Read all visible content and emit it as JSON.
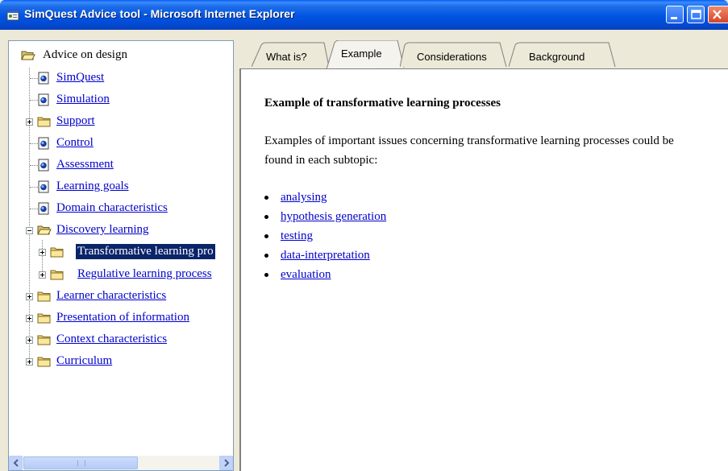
{
  "window": {
    "title": "SimQuest Advice tool - Microsoft Internet Explorer",
    "buttons": [
      "minimize",
      "maximize",
      "close"
    ]
  },
  "tree": {
    "root": {
      "label": "Advice on design",
      "icon": "open-folder-icon"
    },
    "items": [
      {
        "label": "SimQuest",
        "icon": "document-icon",
        "expander": "none"
      },
      {
        "label": "Simulation",
        "icon": "document-icon",
        "expander": "none"
      },
      {
        "label": "Support",
        "icon": "folder-icon",
        "expander": "plus"
      },
      {
        "label": "Control",
        "icon": "document-icon",
        "expander": "none"
      },
      {
        "label": "Assessment",
        "icon": "document-icon",
        "expander": "none"
      },
      {
        "label": "Learning goals",
        "icon": "document-icon",
        "expander": "none"
      },
      {
        "label": "Domain characteristics",
        "icon": "document-icon",
        "expander": "none"
      },
      {
        "label": "Discovery learning",
        "icon": "open-folder-icon",
        "expander": "minus",
        "children": [
          {
            "label": "Transformative learning pro",
            "icon": "folder-icon",
            "expander": "plus",
            "selected": true
          },
          {
            "label": "Regulative learning process",
            "icon": "folder-icon",
            "expander": "plus"
          }
        ]
      },
      {
        "label": "Learner characteristics",
        "icon": "folder-icon",
        "expander": "plus"
      },
      {
        "label": "Presentation of information",
        "icon": "folder-icon",
        "expander": "plus"
      },
      {
        "label": "Context characteristics",
        "icon": "folder-icon",
        "expander": "plus"
      },
      {
        "label": "Curriculum",
        "icon": "folder-icon",
        "expander": "plus"
      }
    ]
  },
  "scrollbar": {
    "left_icon": "arrow-left-icon",
    "right_icon": "arrow-right-icon"
  },
  "tabs": [
    {
      "label": "What is?",
      "active": false
    },
    {
      "label": "Example",
      "active": true
    },
    {
      "label": "Considerations",
      "active": false
    },
    {
      "label": "Background",
      "active": false
    }
  ],
  "content": {
    "title": "Example of transformative learning processes",
    "paragraph": "Examples of important issues concerning transformative learning processes could be found in each subtopic:",
    "links": [
      "analysing",
      "hypothesis generation",
      "testing",
      "data-interpretation",
      "evaluation"
    ]
  },
  "colors": {
    "titlebar": "#0054e3",
    "link": "#0000cc",
    "selection": "#0a246a",
    "window_frame": "#ece9d8"
  }
}
